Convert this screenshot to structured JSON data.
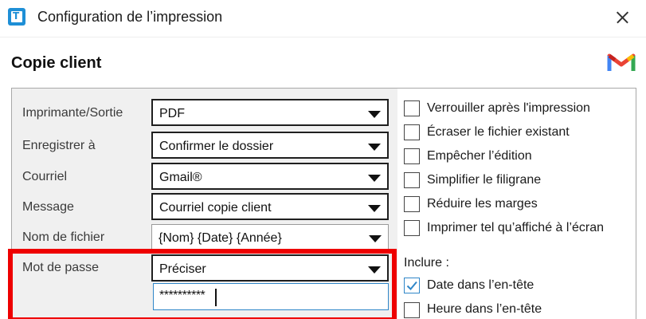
{
  "window": {
    "title": "Configuration de l’impression",
    "app_icon_letter": "T"
  },
  "section": {
    "heading": "Copie client"
  },
  "icons": {
    "app": "app-icon",
    "close": "close-icon",
    "mail": "gmail-icon",
    "dropdown": "chevron-down-icon"
  },
  "form": {
    "printer": {
      "label": "Imprimante/Sortie",
      "value": "PDF"
    },
    "save": {
      "label": "Enregistrer à",
      "value": "Confirmer le dossier"
    },
    "email": {
      "label": "Courriel",
      "value": "Gmail®"
    },
    "message": {
      "label": "Message",
      "value": "Courriel copie client"
    },
    "filename": {
      "label": "Nom de fichier",
      "value": "{Nom} {Date} {Année}"
    },
    "password": {
      "label": "Mot de passe",
      "value": "Préciser",
      "input_value": "**********"
    }
  },
  "options": [
    {
      "label": "Verrouiller après l'impression",
      "checked": false
    },
    {
      "label": "Écraser le fichier existant",
      "checked": false
    },
    {
      "label": "Empêcher l’édition",
      "checked": false
    },
    {
      "label": "Simplifier le filigrane",
      "checked": false
    },
    {
      "label": "Réduire les marges",
      "checked": false
    },
    {
      "label": "Imprimer tel qu’affiché à l’écran",
      "checked": false
    }
  ],
  "include": {
    "label": "Inclure :",
    "items": [
      {
        "label": "Date dans l’en-tête",
        "checked": true
      },
      {
        "label": "Heure dans l’en-tête",
        "checked": false
      }
    ]
  },
  "colors": {
    "accent": "#2f86c8",
    "highlight": "#ee0000",
    "app_icon": "#1e8fd6",
    "form_background": "#f0f0f0"
  }
}
